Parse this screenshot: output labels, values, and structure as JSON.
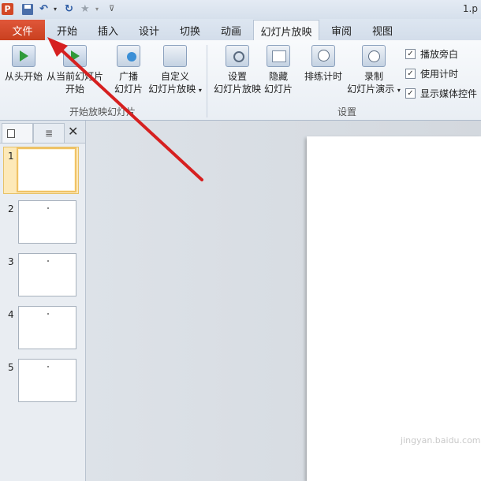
{
  "window": {
    "title": "1.p"
  },
  "app_icon_letter": "P",
  "tabs": {
    "file": "文件",
    "items": [
      {
        "label": "开始"
      },
      {
        "label": "插入"
      },
      {
        "label": "设计"
      },
      {
        "label": "切换"
      },
      {
        "label": "动画"
      },
      {
        "label": "幻灯片放映",
        "active": true
      },
      {
        "label": "审阅"
      },
      {
        "label": "视图"
      }
    ]
  },
  "ribbon": {
    "start_group": {
      "label": "开始放映幻灯片",
      "from_beginning": "从头开始",
      "from_current_line1": "从当前幻灯片",
      "from_current_line2": "开始",
      "broadcast_line1": "广播",
      "broadcast_line2": "幻灯片",
      "custom_line1": "自定义",
      "custom_line2": "幻灯片放映"
    },
    "setup_group": {
      "label": "设置",
      "setup_line1": "设置",
      "setup_line2": "幻灯片放映",
      "hide_line1": "隐藏",
      "hide_line2": "幻灯片",
      "rehearse": "排练计时",
      "record_line1": "录制",
      "record_line2": "幻灯片演示",
      "play_narration": "播放旁白",
      "use_timings": "使用计时",
      "show_media_controls": "显示媒体控件"
    }
  },
  "slide_pane": {
    "outline_tab_icon": "≣",
    "close": "✕",
    "slides": [
      "1",
      "2",
      "3",
      "4",
      "5"
    ],
    "selected": "1"
  },
  "watermark": "jingyan.baidu.com",
  "colors": {
    "file_tab": "#d24726",
    "arrow": "#d62020",
    "selection": "#f0c266"
  }
}
